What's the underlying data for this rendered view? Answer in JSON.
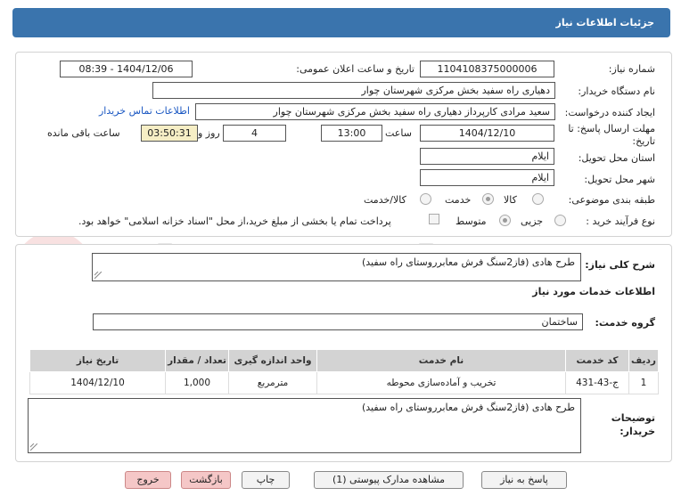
{
  "header": {
    "title": "جزئیات اطلاعات نیاز"
  },
  "watermark": "AriaTender.net",
  "form": {
    "need_number_label": "شماره نیاز:",
    "need_number": "1104108375000006",
    "announce_label": "تاریخ و ساعت اعلان عمومی:",
    "announce_value": "1404/12/06 - 08:39",
    "buyer_label": "نام دستگاه خریدار:",
    "buyer_value": "دهیاری راه سفید بخش مرکزی شهرستان چوار",
    "creator_label": "ایجاد کننده درخواست:",
    "creator_value": "سعید مرادی کارپرداز دهیاری راه سفید بخش مرکزی شهرستان چوار",
    "contact_link": "اطلاعات تماس خریدار",
    "deadline_label_1": "مهلت ارسال پاسخ: تا",
    "deadline_label_2": "تاریخ:",
    "deadline_date": "1404/12/10",
    "time_label": "ساعت",
    "deadline_time": "13:00",
    "days_value": "4",
    "days_label": "روز و",
    "remaining_time": "03:50:31",
    "remaining_label": "ساعت باقی مانده",
    "province_label": "استان محل تحویل:",
    "province_value": "ایلام",
    "city_label": "شهر محل تحویل:",
    "city_value": "ایلام",
    "category_label": "طبقه بندی موضوعی:",
    "category_options": [
      "کالا",
      "خدمت",
      "کالا/خدمت"
    ],
    "process_label": "نوع فرآیند خرید :",
    "process_options": [
      "جزیی",
      "متوسط"
    ],
    "payment_note": "پرداخت تمام یا بخشی از مبلغ خرید،از محل \"اسناد خزانه اسلامی\" خواهد بود."
  },
  "summary": {
    "label": "شرح کلی نیاز:",
    "value": "طرح هادی (فاز2سنگ فرش معابرروستای راه سفید)"
  },
  "services": {
    "section_title": "اطلاعات خدمات مورد نیاز",
    "group_label": "گروه خدمت:",
    "group_value": "ساختمان",
    "columns": [
      "ردیف",
      "کد خدمت",
      "نام خدمت",
      "واحد اندازه گیری",
      "تعداد / مقدار",
      "تاریخ نیاز"
    ],
    "rows": [
      [
        "1",
        "ج-43-431",
        "تخریب و آماده‌سازی محوطه",
        "مترمربع",
        "1,000",
        "1404/12/10"
      ]
    ]
  },
  "buyer_notes": {
    "label_1": "توضیحات",
    "label_2": "خریدار:",
    "value": "طرح هادی (فاز2سنگ فرش معابرروستای راه سفید)"
  },
  "buttons": {
    "reply": "پاسخ به نیاز",
    "attachments": "مشاهده مدارک پیوستی (1)",
    "print": "چاپ",
    "back": "بازگشت",
    "exit": "خروج"
  }
}
